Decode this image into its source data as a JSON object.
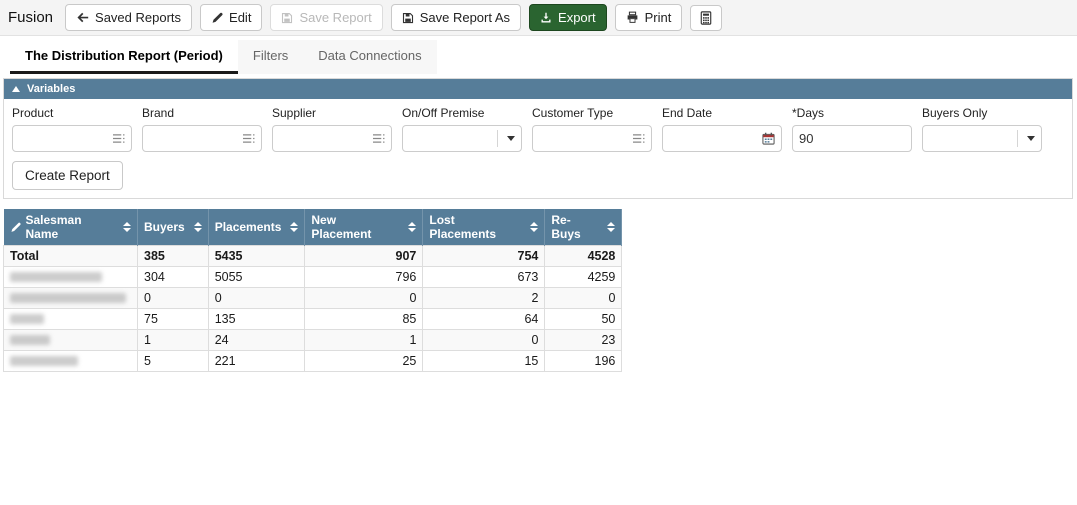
{
  "app": {
    "brand": "Fusion"
  },
  "toolbar": {
    "buttons": [
      {
        "label": "Saved Reports",
        "icon": "arrow-left-icon",
        "state": "default"
      },
      {
        "label": "Edit",
        "icon": "pencil-icon",
        "state": "default"
      },
      {
        "label": "Save Report",
        "icon": "save-icon",
        "state": "disabled"
      },
      {
        "label": "Save Report As",
        "icon": "save-icon",
        "state": "default"
      },
      {
        "label": "Export",
        "icon": "download-icon",
        "state": "primary"
      },
      {
        "label": "Print",
        "icon": "printer-icon",
        "state": "default"
      },
      {
        "label": "",
        "icon": "calculator-icon",
        "state": "default"
      }
    ]
  },
  "tabs": [
    {
      "label": "The Distribution Report (Period)",
      "active": true
    },
    {
      "label": "Filters",
      "active": false
    },
    {
      "label": "Data Connections",
      "active": false
    }
  ],
  "variables_panel": {
    "title": "Variables",
    "fields": [
      {
        "label": "Product",
        "type": "combo-list",
        "value": ""
      },
      {
        "label": "Brand",
        "type": "combo-list",
        "value": ""
      },
      {
        "label": "Supplier",
        "type": "combo-list",
        "value": ""
      },
      {
        "label": "On/Off Premise",
        "type": "select",
        "value": ""
      },
      {
        "label": "Customer Type",
        "type": "combo-list",
        "value": ""
      },
      {
        "label": "End Date",
        "type": "date",
        "value": ""
      },
      {
        "label": "*Days",
        "type": "text",
        "value": "90"
      },
      {
        "label": "Buyers Only",
        "type": "select",
        "value": ""
      }
    ],
    "create_button": "Create Report"
  },
  "table": {
    "columns": [
      "Salesman Name",
      "Buyers",
      "Placements",
      "New Placement",
      "Lost Placements",
      "Re-Buys"
    ],
    "total_row": {
      "label": "Total",
      "values": [
        "385",
        "5435",
        "907",
        "754",
        "4528"
      ]
    },
    "rows": [
      {
        "name_redacted": true,
        "values": [
          "304",
          "5055",
          "796",
          "673",
          "4259"
        ]
      },
      {
        "name_redacted": true,
        "values": [
          "0",
          "0",
          "0",
          "2",
          "0"
        ]
      },
      {
        "name_redacted": true,
        "values": [
          "75",
          "135",
          "85",
          "64",
          "50"
        ]
      },
      {
        "name_redacted": true,
        "values": [
          "1",
          "24",
          "1",
          "0",
          "23"
        ]
      },
      {
        "name_redacted": true,
        "values": [
          "5",
          "221",
          "25",
          "15",
          "196"
        ]
      }
    ]
  },
  "colors": {
    "header_blue": "#567d99",
    "export_green": "#2a6430"
  }
}
